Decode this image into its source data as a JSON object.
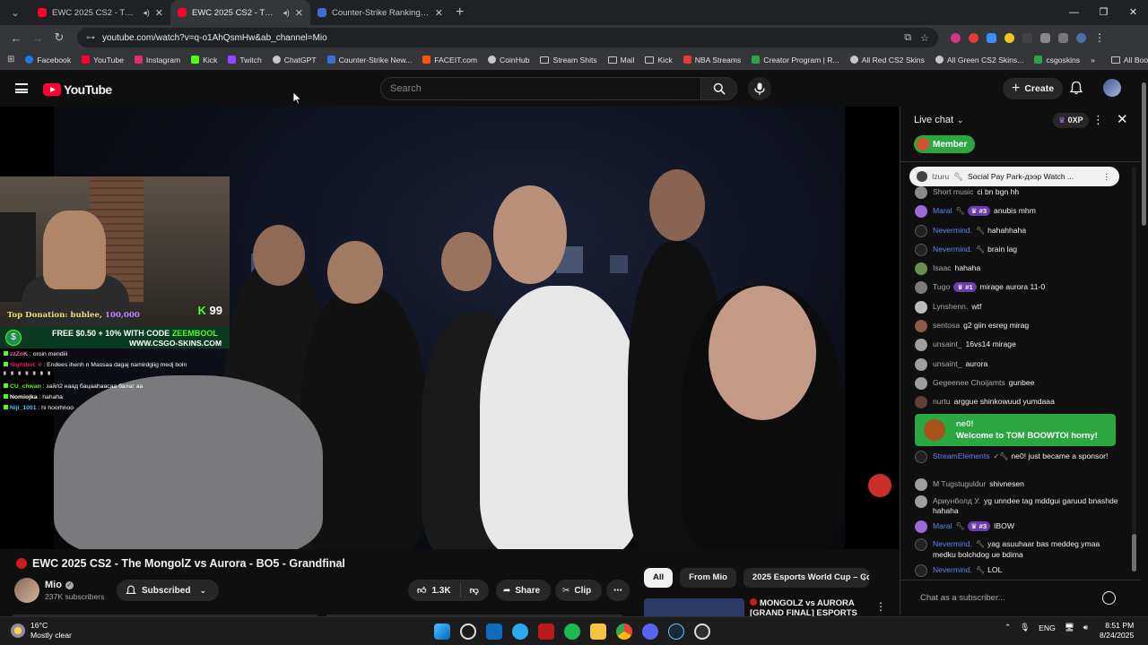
{
  "browser": {
    "tabs": [
      {
        "title": "EWC 2025 CS2 - The Mongol",
        "active": false,
        "color": "#ff0033"
      },
      {
        "title": "EWC 2025 CS2 - The M",
        "active": true,
        "color": "#ff0033"
      },
      {
        "title": "Counter-Strike Ranking | World",
        "active": false,
        "color": "#3b6fd1"
      }
    ],
    "url": "youtube.com/watch?v=q-o1AhQsmHw&ab_channel=Mio",
    "bookmarks": [
      {
        "label": "Facebook",
        "icon": "facebook-icon",
        "color": "#1877f2"
      },
      {
        "label": "YouTube",
        "icon": "youtube-icon",
        "color": "#ff0033"
      },
      {
        "label": "Instagram",
        "icon": "instagram-icon",
        "color": "#e1306c"
      },
      {
        "label": "Kick",
        "icon": "kick-icon",
        "color": "#53fc18"
      },
      {
        "label": "Twitch",
        "icon": "twitch-icon",
        "color": "#9146ff"
      },
      {
        "label": "ChatGPT",
        "icon": "chatgpt-icon",
        "color": "#c4c7c5"
      },
      {
        "label": "Counter-Strike New...",
        "icon": "hltv-icon",
        "color": "#3b6fd1"
      },
      {
        "label": "FACEIT.com",
        "icon": "faceit-icon",
        "color": "#ff5500"
      },
      {
        "label": "CoinHub",
        "icon": "globe-icon",
        "color": "#c4c7c5"
      },
      {
        "label": "Stream Shits",
        "icon": "folder-icon",
        "color": ""
      },
      {
        "label": "Mail",
        "icon": "folder-icon",
        "color": ""
      },
      {
        "label": "Kick",
        "icon": "folder-icon",
        "color": ""
      },
      {
        "label": "NBA Streams",
        "icon": "streams-icon",
        "color": "#e53935"
      },
      {
        "label": "Creator Program | R...",
        "icon": "creator-icon",
        "color": "#2ba640"
      },
      {
        "label": "All Red CS2 Skins",
        "icon": "globe-icon",
        "color": "#c4c7c5"
      },
      {
        "label": "All Green CS2 Skins...",
        "icon": "globe-icon",
        "color": "#c4c7c5"
      },
      {
        "label": "csgoskins",
        "icon": "csgoskins-icon",
        "color": "#2ba640"
      }
    ],
    "all_bookmarks": "All Bookmarks"
  },
  "youtube": {
    "logo_text": "YouTube",
    "search_placeholder": "Search",
    "create_label": "Create"
  },
  "video_overlay": {
    "donation_label": "Top Donation: bublee,",
    "donation_amount": "100,000",
    "kick_count": "99",
    "promo_line1_prefix": "FREE $0.50 + 10% WITH CODE",
    "promo_code": "ZEEMBOOL",
    "promo_line2": "WWW.CSGO-SKINS.COM",
    "kick_chat": [
      {
        "user": "zzZoK",
        "text": "oroin mendiii",
        "color": "#ff6b9d"
      },
      {
        "user": "Nightbot_0",
        "text": "Endees ihenh n Massaa dagaj namirdgiig medj boln",
        "color": "#e91e63"
      },
      {
        "user": "CU_chwan",
        "text": "зайл2 наад бацааhаасаа балаг аа",
        "color": "#53fc18"
      },
      {
        "user": "Nomiojka",
        "text": "hahaha",
        "color": "#ffffff"
      },
      {
        "user": "Niji_1001",
        "text": "hi hoorhnoo",
        "color": "#4fc3f7"
      }
    ]
  },
  "video": {
    "title": "EWC 2025 CS2 - The MongolZ vs Aurora - BO5 - Grandfinal",
    "channel": "Mio",
    "subscribers": "237K subscribers",
    "subscribed_label": "Subscribed",
    "likes": "1.3K",
    "share_label": "Share",
    "clip_label": "Clip"
  },
  "chips": [
    "All",
    "From Mio",
    "2025 Esports World Cup – Cou"
  ],
  "recommendation": {
    "title": "MONGOLZ vs AURORA [GRAND FINAL] ESPORTS"
  },
  "chat": {
    "title": "Live chat",
    "xp": "0XP",
    "member_label": "Member",
    "pinned": {
      "author": "Izuru",
      "text": "Social Pay Park-дээр Watch ..."
    },
    "messages": [
      {
        "author": "Short music",
        "text": "ci bn bgn hh",
        "kind": "",
        "badge": "",
        "color": "#8a8a8a"
      },
      {
        "author": "Maral",
        "text": "anubis mhm",
        "kind": "mod",
        "badge": "#3",
        "color": "#9c6ad6"
      },
      {
        "author": "Nevermind.",
        "text": "hahahhaha",
        "kind": "mod",
        "badge": "",
        "color": "#222222"
      },
      {
        "author": "Nevermind.",
        "text": "brain lag",
        "kind": "mod",
        "badge": "",
        "color": "#222222"
      },
      {
        "author": "Isaac",
        "text": "hahaha",
        "kind": "",
        "badge": "",
        "color": "#6b8e4e"
      },
      {
        "author": "Tugo",
        "text": "mirage aurora 11-0",
        "kind": "",
        "badge": "#1",
        "color": "#7a7a7a"
      },
      {
        "author": "Lynshenn.",
        "text": "wtf",
        "kind": "",
        "badge": "",
        "color": "#bdbdbd"
      },
      {
        "author": "sentosa",
        "text": "g2 giin esreg mirag",
        "kind": "",
        "badge": "",
        "color": "#8a5a4a"
      },
      {
        "author": "unsaint_",
        "text": "16vs14 mirage",
        "kind": "",
        "badge": "",
        "color": "#9e9e9e"
      },
      {
        "author": "unsaint_",
        "text": "aurora",
        "kind": "",
        "badge": "",
        "color": "#9e9e9e"
      },
      {
        "author": "Gegeenee Choijamts",
        "text": "gunbee",
        "kind": "",
        "badge": "",
        "color": "#9e9e9e"
      },
      {
        "author": "nurtu",
        "text": "arggue shinkowuud yumdaaa",
        "kind": "",
        "badge": "",
        "color": "#5d4037"
      }
    ],
    "welcome": {
      "author": "ne0!",
      "text": "Welcome to TOM BOOWTOI horny!"
    },
    "messages_after": [
      {
        "author": "StreamElements",
        "text": "ne0! just became a sponsor!",
        "kind": "mod",
        "badge": "",
        "color": "#222222"
      },
      {
        "author": "M Tugstuguldur",
        "text": "shivnesen",
        "kind": "",
        "badge": "",
        "color": "#9e9e9e"
      },
      {
        "author": "Ариунболд У.",
        "text": "yg unndee tag mddgui garuud bnashde hahaha",
        "kind": "",
        "badge": "",
        "color": "#9e9e9e"
      },
      {
        "author": "Maral",
        "text": "IBOW",
        "kind": "mod",
        "badge": "#3",
        "color": "#9c6ad6"
      },
      {
        "author": "Nevermind.",
        "text": "yag asuuhaar bas meddeg ymaa medku bolchdog ue bdima",
        "kind": "mod",
        "badge": "",
        "color": "#222222"
      },
      {
        "author": "Nevermind.",
        "text": "LOL",
        "kind": "mod",
        "badge": "",
        "color": "#222222"
      }
    ],
    "input_placeholder": "Chat as a subscriber..."
  },
  "taskbar": {
    "temperature": "16°C",
    "weather": "Mostly clear",
    "language": "ENG",
    "time": "8:51 PM",
    "date": "8/24/2025"
  }
}
